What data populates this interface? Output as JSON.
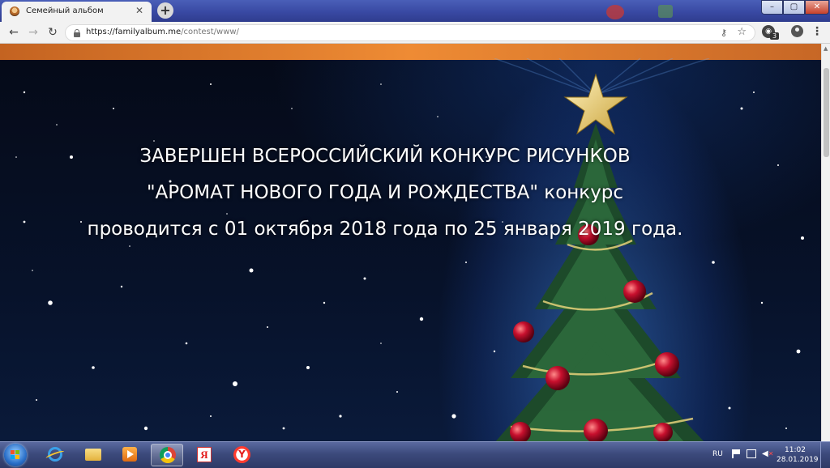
{
  "browser": {
    "tab": {
      "title": "Семейный альбом",
      "close_symbol": "✕"
    },
    "new_tab_symbol": "+",
    "window_controls": {
      "minimize": "–",
      "maximize": "▢",
      "close": "✕"
    },
    "toolbar": {
      "back_symbol": "←",
      "forward_symbol": "→",
      "reload_symbol": "↻",
      "url_host": "https://familyalbum.me",
      "url_path": "/contest/www/",
      "extension_badge": "3"
    }
  },
  "page": {
    "headline": {
      "line1": "ЗАВЕРШЕН ВСЕРОССИЙСКИЙ КОНКУРС РИСУНКОВ",
      "line2": "\"АРОМАТ НОВОГО ГОДА И РОЖДЕСТВА\" конкурс",
      "line3": "проводится с 01 октября 2018 года по 25 января 2019 года."
    },
    "colors": {
      "header_orange": "#ee8b34",
      "sky": "#050a18",
      "text": "#ffffff"
    }
  },
  "taskbar": {
    "apps": [
      {
        "name": "internet-explorer",
        "icon": "ie-icon"
      },
      {
        "name": "file-explorer",
        "icon": "folder-icon"
      },
      {
        "name": "media-player",
        "icon": "media-icon"
      },
      {
        "name": "google-chrome",
        "icon": "chrome-icon",
        "active": true
      },
      {
        "name": "yandex",
        "icon": "yandex-icon",
        "glyph": "Я"
      },
      {
        "name": "yandex-browser",
        "icon": "yandex-browser-icon",
        "glyph": "Y"
      }
    ],
    "tray": {
      "language": "RU",
      "time": "11:02",
      "date": "28.01.2019"
    }
  }
}
